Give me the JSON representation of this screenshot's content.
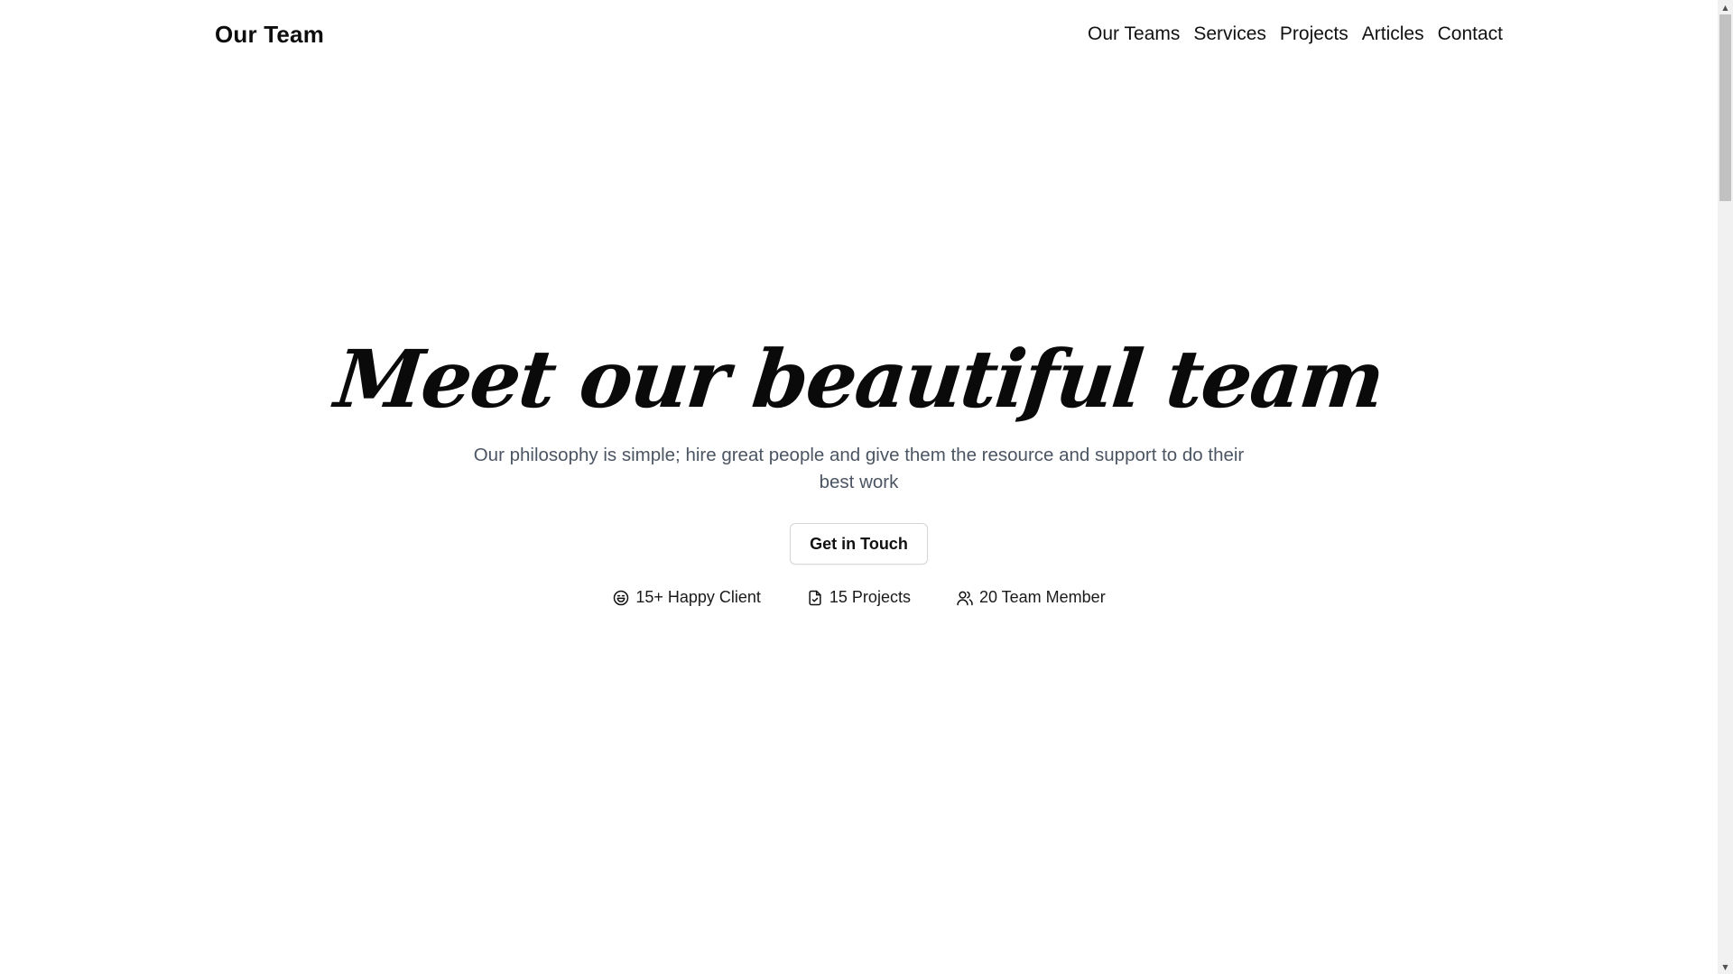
{
  "header": {
    "brand": "Our Team",
    "nav": [
      {
        "label": "Our Teams"
      },
      {
        "label": "Services"
      },
      {
        "label": "Projects"
      },
      {
        "label": "Articles"
      },
      {
        "label": "Contact"
      }
    ]
  },
  "hero": {
    "title": "Meet our beautiful team",
    "subtitle": "Our philosophy is simple; hire great people and give them the resource and support to do their best work",
    "cta_label": "Get in Touch",
    "stats": [
      {
        "icon": "smile-icon",
        "label": "15+ Happy Client"
      },
      {
        "icon": "file-check-icon",
        "label": "15 Projects"
      },
      {
        "icon": "users-icon",
        "label": "20 Team Member"
      }
    ]
  },
  "scrollbar": {
    "up_arrow": "▲",
    "down_arrow": "▼"
  },
  "colors": {
    "background": "#ffffff",
    "text": "#111111",
    "subtitle": "#4b5563",
    "button_border": "#d6d6d6",
    "scroll_track": "#f1f1f1",
    "scroll_thumb": "#c1c1c1"
  }
}
